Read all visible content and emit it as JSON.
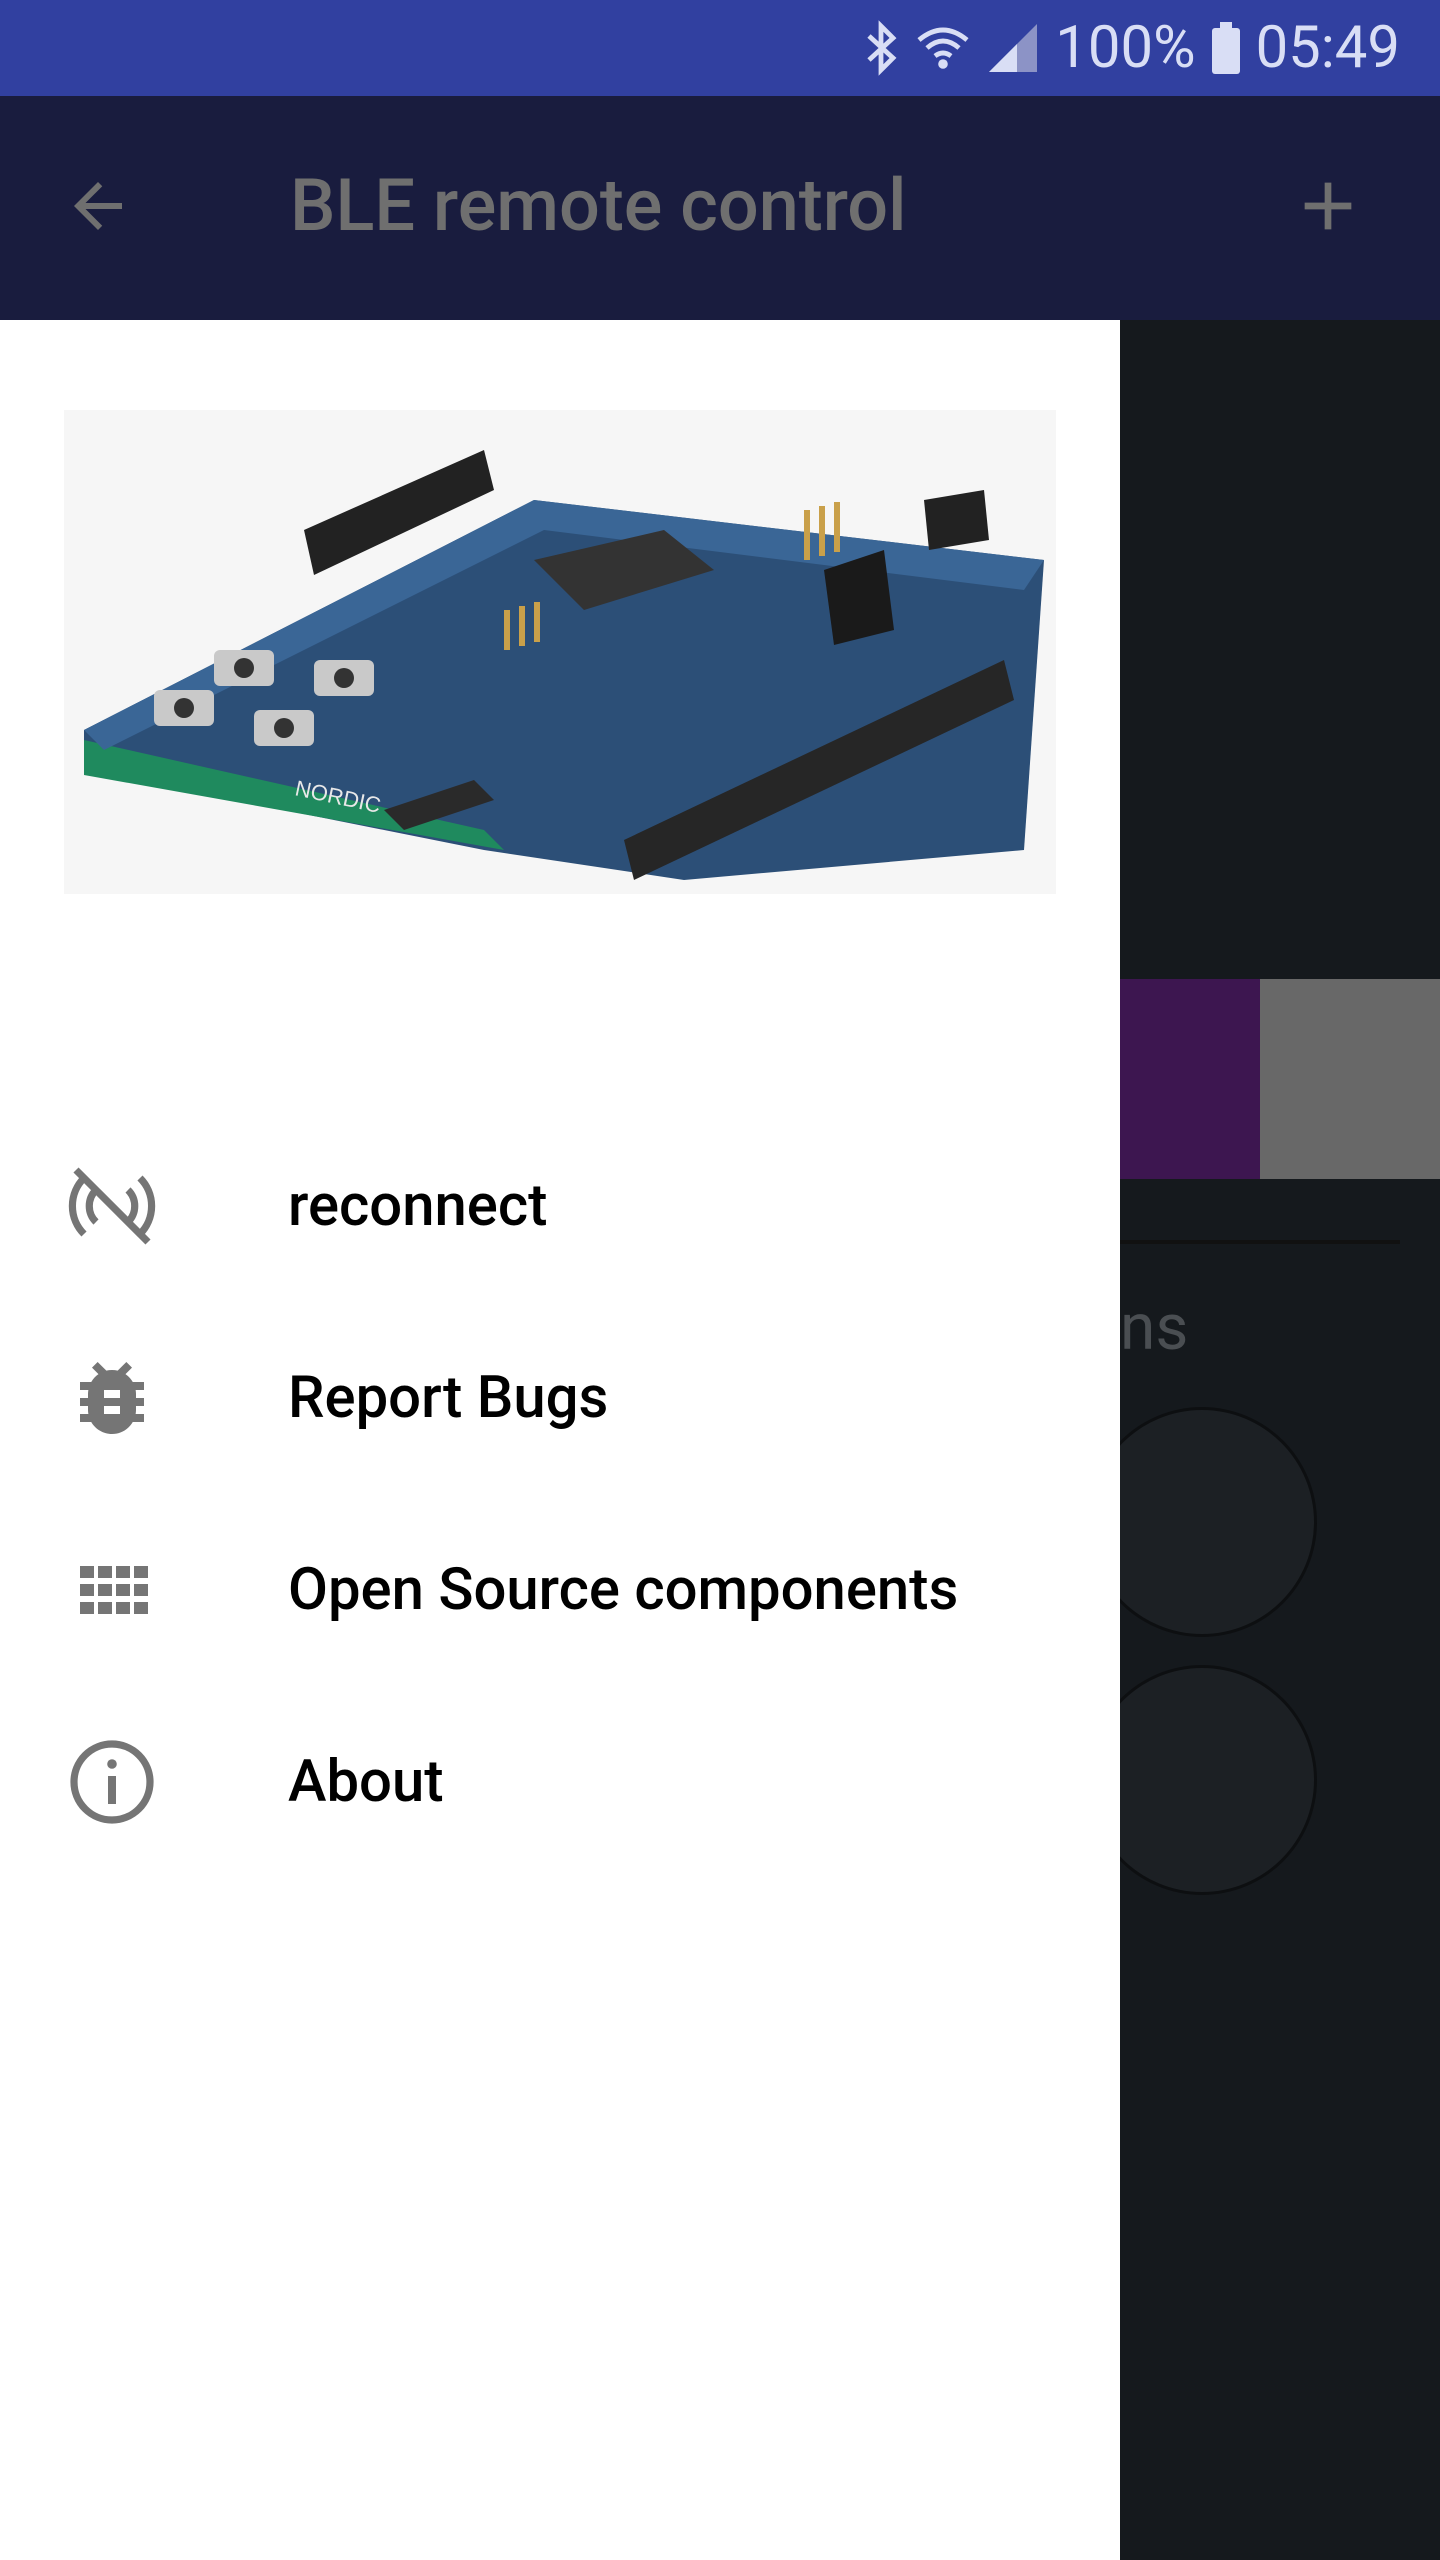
{
  "status_bar": {
    "battery": "100%",
    "time": "05:49",
    "icons": [
      "bluetooth-icon",
      "wifi-icon",
      "signal-icon",
      "battery-icon"
    ]
  },
  "app_bar": {
    "title": "BLE remote control",
    "back_icon": "arrow-back-icon",
    "add_icon": "plus-icon"
  },
  "background": {
    "partial_label": "ns"
  },
  "drawer": {
    "header_image": "nordic-dev-board-image",
    "items": [
      {
        "label": "reconnect",
        "icon": "signal-off-icon"
      },
      {
        "label": "Report Bugs",
        "icon": "bug-icon"
      },
      {
        "label": "Open Source components",
        "icon": "grid-icon"
      },
      {
        "label": "About",
        "icon": "info-icon"
      }
    ]
  },
  "colors": {
    "status_bar": "#3140a0",
    "app_bar": "#191c3e",
    "scrim": "#15191d",
    "accent_purple": "#3d1650"
  }
}
